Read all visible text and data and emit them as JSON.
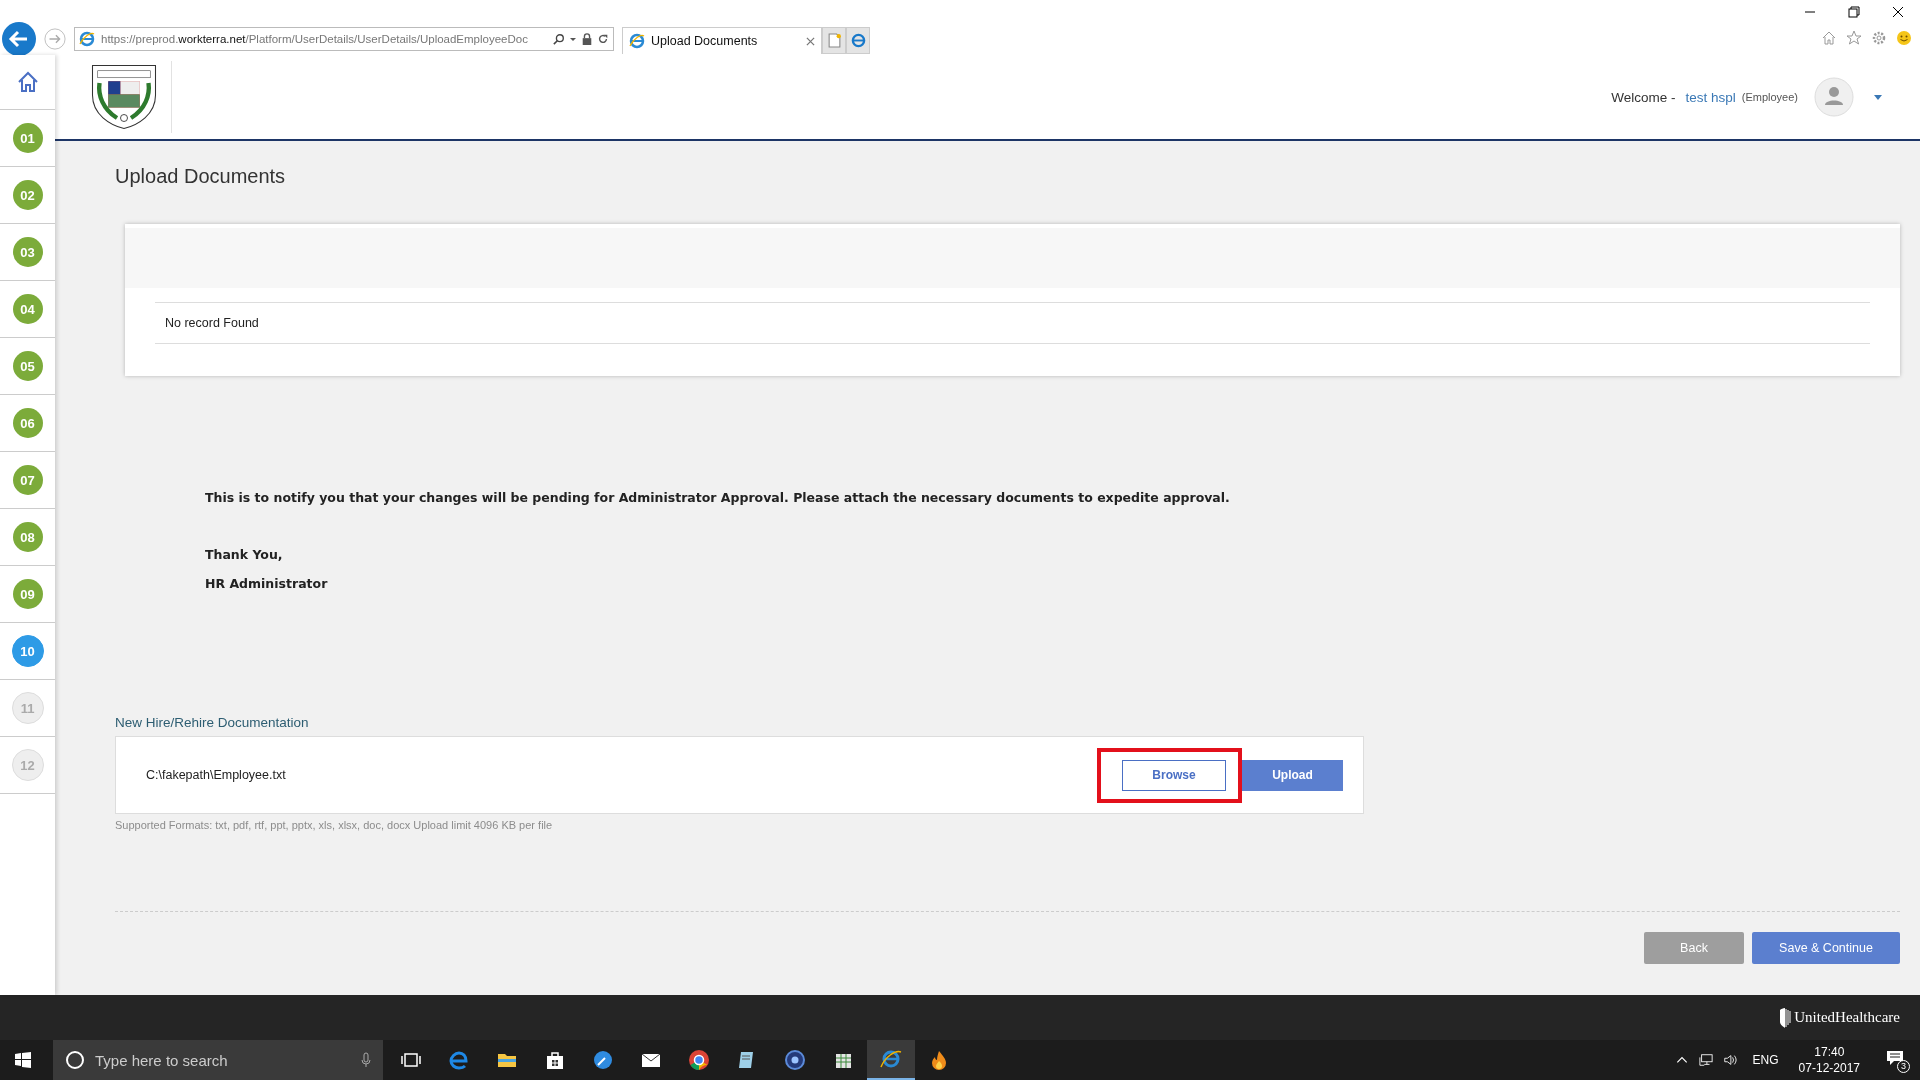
{
  "browser": {
    "url": "https://preprod.**workterra.net**/Platform/UserDetails/UserDetails/UploadEmployeeDoc",
    "tab_title": "Upload Documents"
  },
  "header": {
    "welcome": "Welcome -",
    "user_name": "test hspl",
    "user_role": "(Employee)"
  },
  "sidebar": {
    "steps": [
      {
        "label": "01",
        "completed": true,
        "selected": false
      },
      {
        "label": "02",
        "completed": true,
        "selected": false
      },
      {
        "label": "03",
        "completed": true,
        "selected": false
      },
      {
        "label": "04",
        "completed": true,
        "selected": false
      },
      {
        "label": "05",
        "completed": true,
        "selected": false
      },
      {
        "label": "06",
        "completed": true,
        "selected": false
      },
      {
        "label": "07",
        "completed": true,
        "selected": false
      },
      {
        "label": "08",
        "completed": true,
        "selected": false
      },
      {
        "label": "09",
        "completed": true,
        "selected": false
      },
      {
        "label": "10",
        "completed": false,
        "selected": true
      },
      {
        "label": "11",
        "completed": false,
        "selected": false
      },
      {
        "label": "12",
        "completed": false,
        "selected": false
      }
    ]
  },
  "page_title": "Upload Documents",
  "table": {
    "empty_message": "No record Found"
  },
  "notice": {
    "message": "This is to notify you that your changes will be pending for Administrator Approval. Please attach the necessary documents to expedite approval.",
    "closing": "Thank You,",
    "signature": "HR Administrator"
  },
  "upload": {
    "section_title": "New Hire/Rehire Documentation",
    "file_path": "C:\\fakepath\\Employee.txt",
    "browse_label": "Browse",
    "browse_highlighted": true,
    "upload_label": "Upload",
    "formats_note": "Supported Formats: txt, pdf, rtf, ppt, pptx, xls, xlsx, doc, docx Upload limit 4096 KB per file"
  },
  "actions": [
    {
      "label": "Back",
      "kind": "secondary"
    },
    {
      "label": "Save & Continue",
      "kind": "primary"
    }
  ],
  "footer": {
    "brand": "UnitedHealthcare"
  },
  "taskbar": {
    "search_placeholder": "Type here to search",
    "language": "ENG",
    "time": "17:40",
    "date": "07-12-2017",
    "notification_count": "3"
  }
}
